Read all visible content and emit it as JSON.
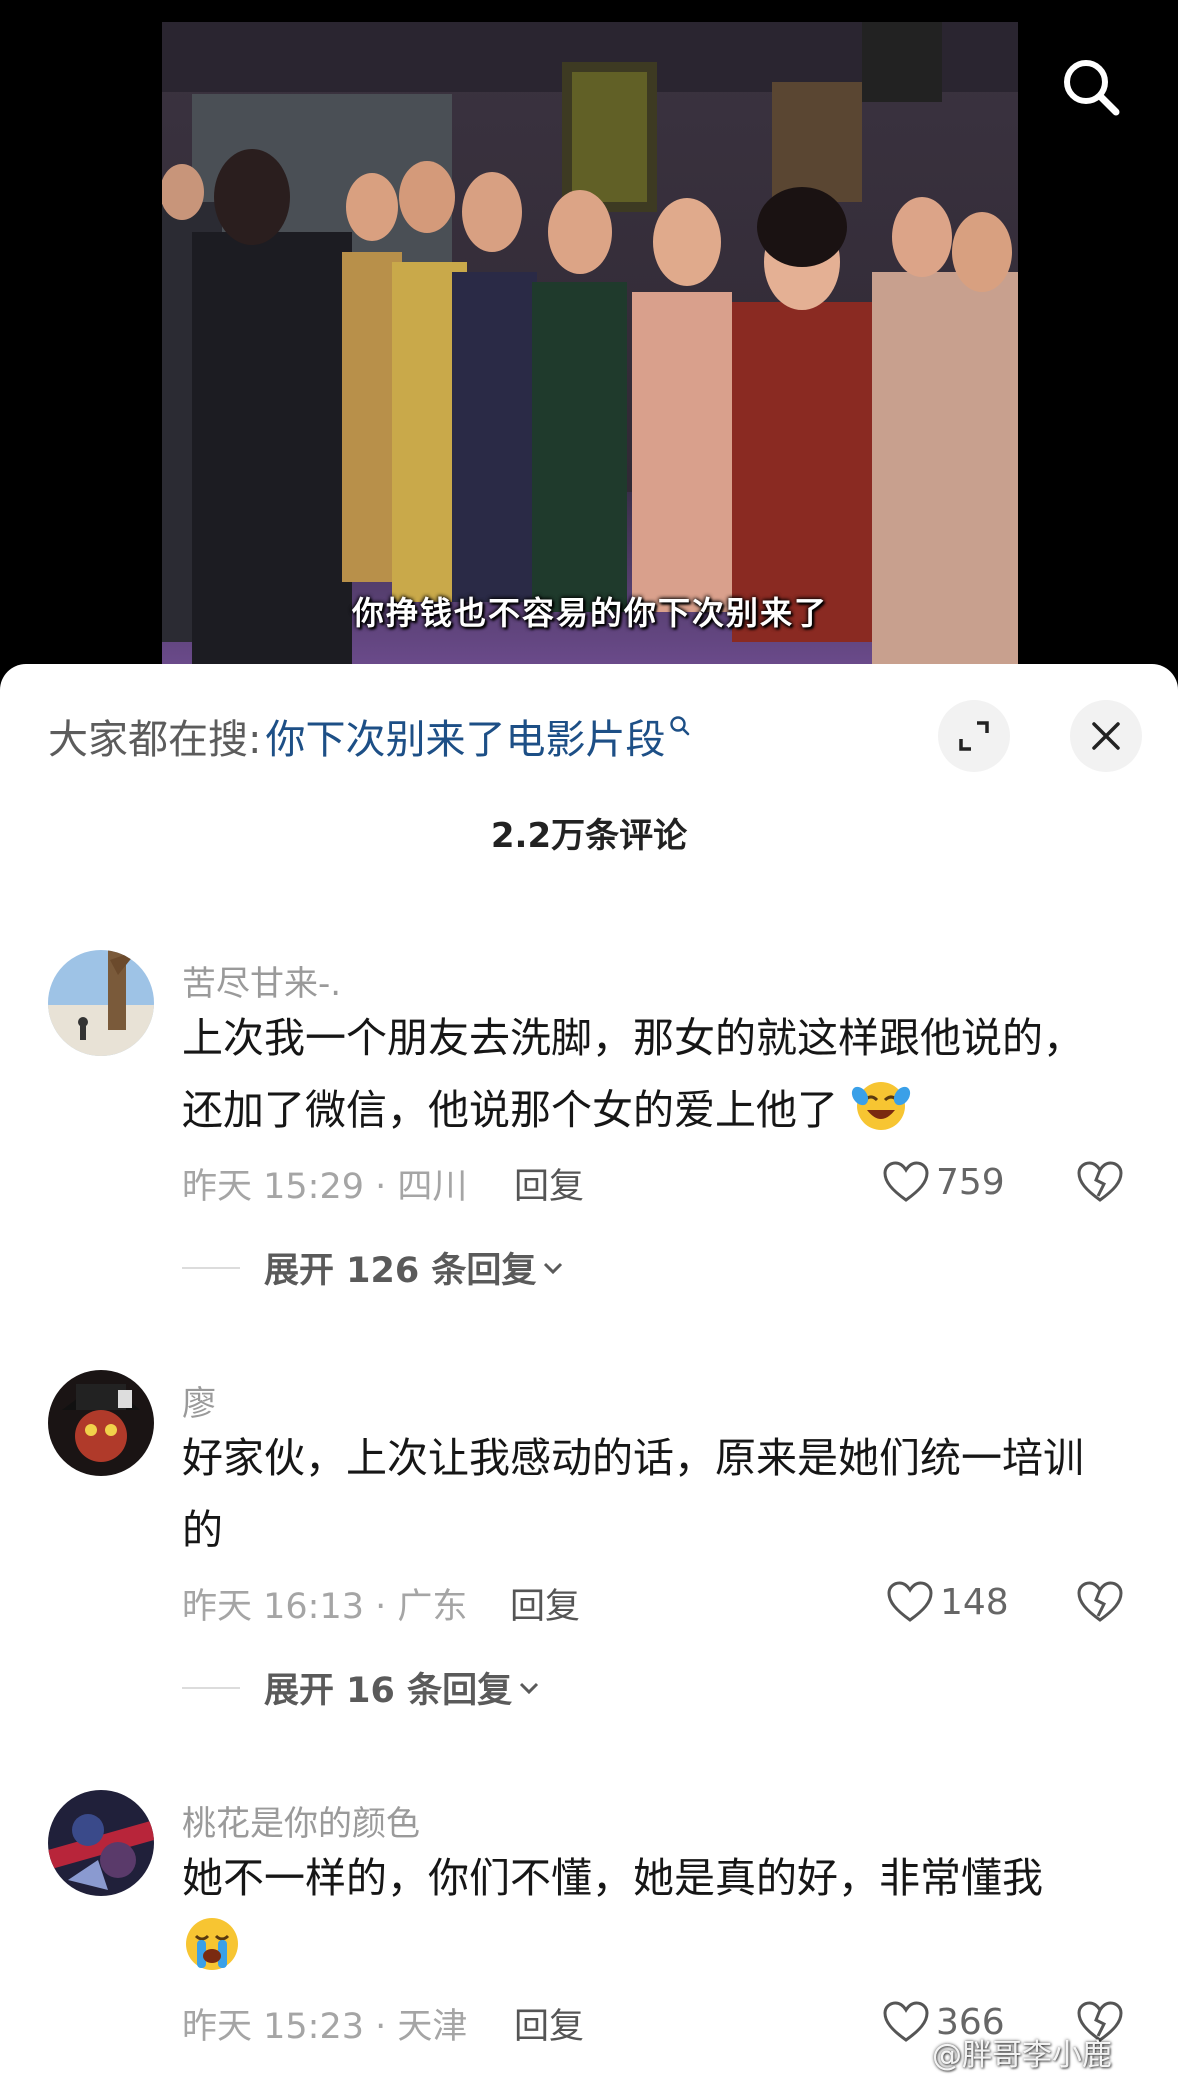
{
  "video": {
    "subtitle": "你挣钱也不容易的你下次别来了",
    "search_icon": "search-icon"
  },
  "panel": {
    "search_prefix": "大家都在搜:",
    "search_query": "你下次别来了电影片段",
    "expand_icon": "expand-icon",
    "close_icon": "close-icon",
    "comment_count": "2.2万条评论"
  },
  "comments": [
    {
      "username": "苦尽甘来-.",
      "text": "上次我一个朋友去洗脚，那女的就这样跟他说的，还加了微信，他说那个女的爱上他了",
      "emoji": "crying-laughing-emoji",
      "time_location": "昨天 15:29 · 四川",
      "reply_label": "回复",
      "likes": "759",
      "expand_label": "展开 126 条回复"
    },
    {
      "username": "廖",
      "text": "好家伙，上次让我感动的话，原来是她们统一培训的",
      "emoji": "",
      "time_location": "昨天 16:13 · 广东",
      "reply_label": "回复",
      "likes": "148",
      "expand_label": "展开 16 条回复"
    },
    {
      "username": "桃花是你的颜色",
      "text": "她不一样的，你们不懂，她是真的好，非常懂我",
      "emoji": "loudly-crying-emoji",
      "time_location": "昨天 15:23 · 天津",
      "reply_label": "回复",
      "likes": "366",
      "expand_label": ""
    }
  ],
  "watermark": "@胖哥李小鹿",
  "colors": {
    "link": "#1d4f86",
    "muted": "#9a9a9a",
    "text": "#161616"
  }
}
